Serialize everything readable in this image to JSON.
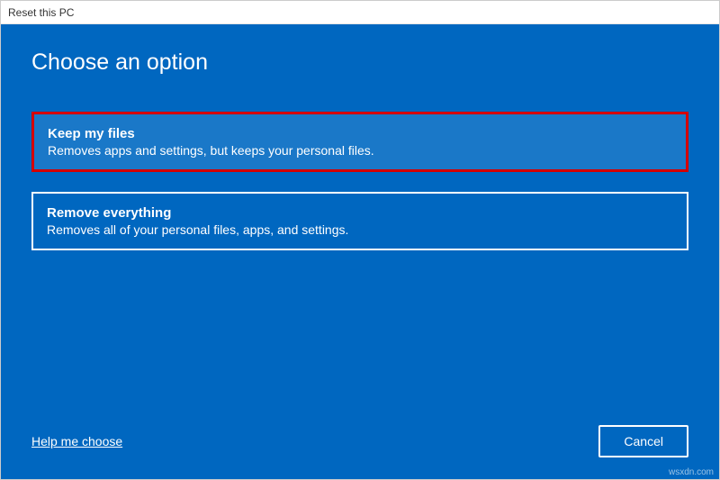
{
  "titlebar": {
    "title": "Reset this PC"
  },
  "content": {
    "heading": "Choose an option"
  },
  "options": {
    "keep": {
      "title": "Keep my files",
      "desc": "Removes apps and settings, but keeps your personal files."
    },
    "remove": {
      "title": "Remove everything",
      "desc": "Removes all of your personal files, apps, and settings."
    }
  },
  "footer": {
    "help": "Help me choose",
    "cancel": "Cancel"
  },
  "watermark": "wsxdn.com"
}
